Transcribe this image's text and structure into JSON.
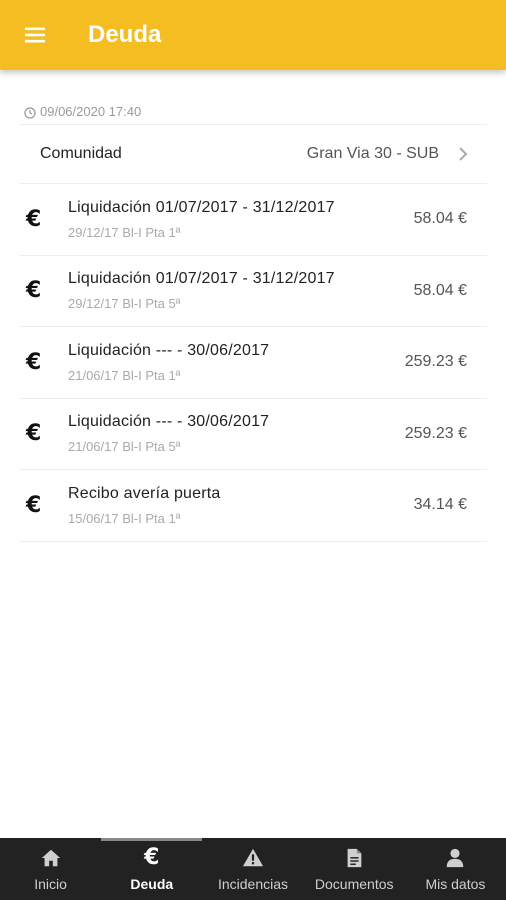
{
  "header": {
    "title": "Deuda",
    "menu_icon": "hamburger-menu-icon",
    "color": "#f4bd22"
  },
  "timestamp": {
    "icon": "clock-icon",
    "text": "09/06/2020 17:40"
  },
  "community": {
    "label": "Comunidad",
    "value": "Gran Via 30 - SUB",
    "icon": "chevron-right-icon"
  },
  "items": [
    {
      "icon": "€",
      "title": "Liquidación 01/07/2017 - 31/12/2017",
      "subtitle": "29/12/17 Bl-I Pta 1ª",
      "amount": "58.04 €"
    },
    {
      "icon": "€",
      "title": "Liquidación 01/07/2017 - 31/12/2017",
      "subtitle": "29/12/17 Bl-I Pta 5ª",
      "amount": "58.04 €"
    },
    {
      "icon": "€",
      "title": "Liquidación --- - 30/06/2017",
      "subtitle": "21/06/17 Bl-I Pta 1ª",
      "amount": "259.23 €"
    },
    {
      "icon": "€",
      "title": "Liquidación --- - 30/06/2017",
      "subtitle": "21/06/17 Bl-I Pta 5ª",
      "amount": "259.23 €"
    },
    {
      "icon": "€",
      "title": "Recibo avería puerta",
      "subtitle": "15/06/17 Bl-I Pta 1ª",
      "amount": "34.14 €"
    }
  ],
  "nav": {
    "inicio": {
      "label": "Inicio",
      "icon": "home-icon"
    },
    "deuda": {
      "label": "Deuda",
      "icon": "€",
      "active": true
    },
    "incidencias": {
      "label": "Incidencias",
      "icon": "warning-icon"
    },
    "documentos": {
      "label": "Documentos",
      "icon": "document-icon"
    },
    "mis_datos": {
      "label": "Mis datos",
      "icon": "user-icon"
    }
  }
}
